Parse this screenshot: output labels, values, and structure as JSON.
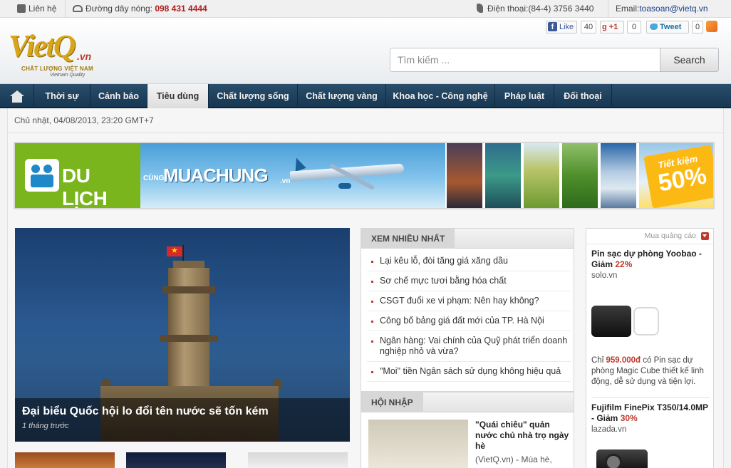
{
  "topbar": {
    "contact": "Liên hệ",
    "hotline_label": "Đường dây nóng:",
    "hotline_number": "098 431 4444",
    "phone_label": "Điện thoại:(84-4) 3756 3440",
    "email_label": "Email:",
    "email": "toasoan@vietq.vn"
  },
  "header": {
    "logo_mark": "VietQ",
    "logo_tld": ".vn",
    "logo_line1": "CHẤT LƯỢNG VIỆT NAM",
    "logo_line2": "Vietnam Quality",
    "social": {
      "fb_like": "Like",
      "fb_count": "40",
      "gplus": "+1",
      "gplus_count": "0",
      "tweet": "Tweet",
      "tweet_count": "0"
    },
    "search_placeholder": "Tìm kiếm ...",
    "search_button": "Search"
  },
  "nav": {
    "items": [
      {
        "label": "Thời sự"
      },
      {
        "label": "Cảnh báo"
      },
      {
        "label": "Tiêu dùng"
      },
      {
        "label": "Chất lượng sống"
      },
      {
        "label": "Chất lượng vàng"
      },
      {
        "label": "Khoa học - Công nghệ"
      },
      {
        "label": "Pháp luật"
      },
      {
        "label": "Đối thoại"
      }
    ],
    "active": "Tiêu dùng"
  },
  "date": "Chủ nhật, 04/08/2013, 23:20 GMT+7",
  "banner": {
    "brand": "DU LỊCH",
    "cung": "CÙNG",
    "muachung": "MUACHUNG",
    "tld": ".vn",
    "save_line1": "Tiết kiệm",
    "save_line2": "50%"
  },
  "featured": {
    "title": "Đại biểu Quốc hội lo đổi tên nước sẽ tốn kém",
    "time": "1 tháng trước"
  },
  "most_viewed": {
    "heading": "XEM NHIỀU NHẤT",
    "items": [
      "Lại kêu lỗ, đòi tăng giá xăng dầu",
      "Sơ chế mực tươi bằng hóa chất",
      "CSGT đuổi xe vi phạm: Nên hay không?",
      "Công bố bảng giá đất mới của TP. Hà Nội",
      "Ngân hàng: Vai chính của Quỹ phát triển doanh nghiệp nhỏ và vừa?",
      "\"Moi\" tiền Ngân sách sử dụng không hiệu quả"
    ]
  },
  "hoi_nhap": {
    "heading": "HỘI NHẬP",
    "title": "\"Quái chiêu\" quản nước chủ nhà trọ ngày hè",
    "desc": "(VietQ.vn) - Mùa hè,"
  },
  "ads": {
    "label": "Mua quảng cáo",
    "ad1": {
      "title": "Pin sạc dự phòng Yoobao - Giảm ",
      "discount": "22%",
      "site": "solo.vn",
      "desc_prefix": "Chỉ ",
      "price": "959.000đ",
      "desc_suffix": " có Pin sạc dự phòng Magic Cube thiết kế linh động, dễ sử dụng và tiện lợi."
    },
    "ad2": {
      "title": "Fujifilm FinePix T350/14.0MP - Giảm ",
      "discount": "30%",
      "site": "lazada.vn"
    }
  }
}
